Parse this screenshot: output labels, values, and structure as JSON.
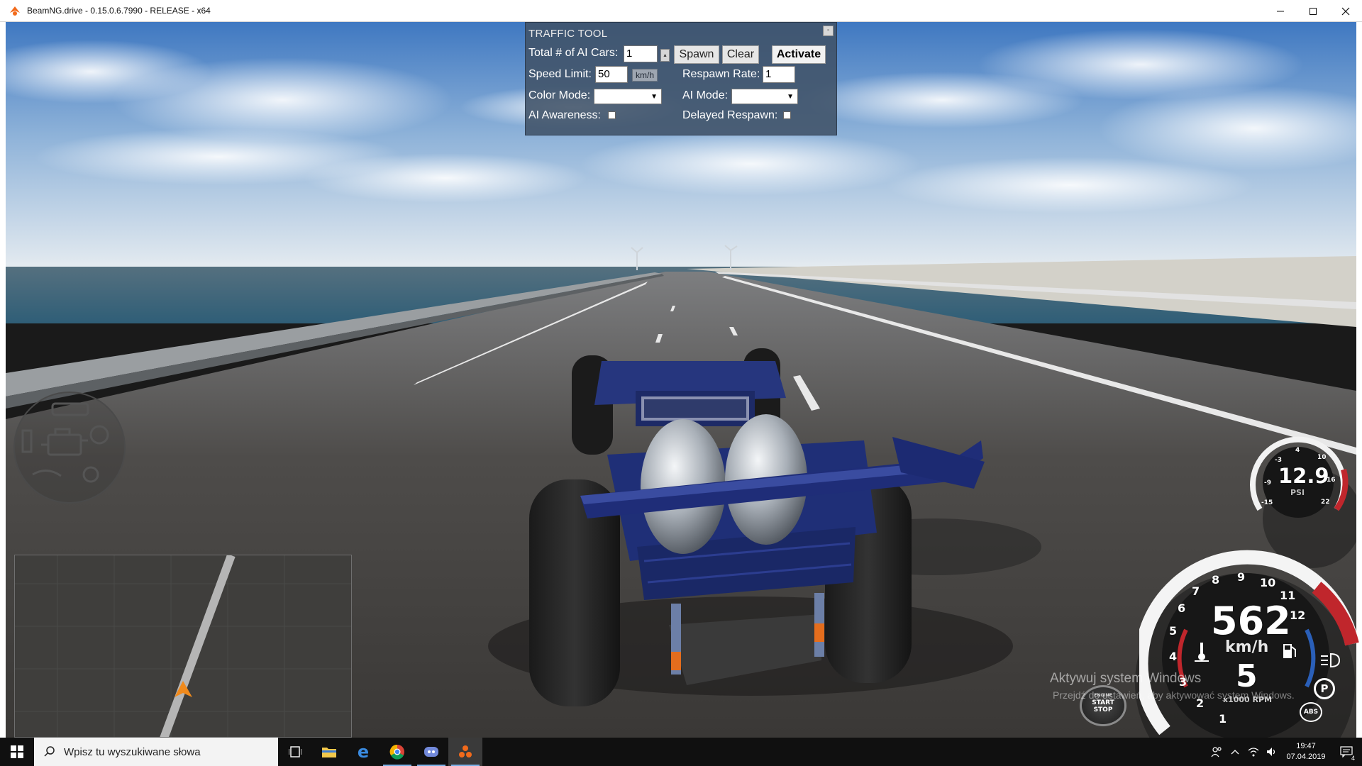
{
  "window": {
    "title": "BeamNG.drive - 0.15.0.6.7990 - RELEASE - x64"
  },
  "traffic_tool": {
    "title": "TRAFFIC TOOL",
    "minimize_label": "-",
    "total_ai_cars_label": "Total # of AI Cars:",
    "total_ai_cars_value": "1",
    "spawn_label": "Spawn",
    "clear_label": "Clear",
    "activate_label": "Activate",
    "speed_limit_label": "Speed Limit:",
    "speed_limit_value": "50",
    "speed_unit": "km/h",
    "respawn_rate_label": "Respawn Rate:",
    "respawn_rate_value": "1",
    "color_mode_label": "Color Mode:",
    "color_mode_value": "",
    "ai_mode_label": "AI Mode:",
    "ai_mode_value": "",
    "ai_awareness_label": "AI Awareness:",
    "ai_awareness_checked": false,
    "delayed_respawn_label": "Delayed Respawn:",
    "delayed_respawn_checked": false
  },
  "boost_gauge": {
    "value": "12.9",
    "unit": "PSI",
    "ticks": [
      "-15",
      "-9",
      "-3",
      "4",
      "10",
      "16",
      "22"
    ]
  },
  "speedometer": {
    "speed": "562",
    "speed_unit": "km/h",
    "gear": "5",
    "rpm_unit": "x1000 RPM",
    "rpm_ticks": [
      "1",
      "2",
      "3",
      "4",
      "5",
      "6",
      "7",
      "8",
      "9",
      "10",
      "11",
      "12"
    ],
    "abs_label": "ABS",
    "park_label": "P"
  },
  "engine_button": {
    "line1": "ENGINE",
    "line2": "START",
    "line3": "STOP"
  },
  "watermark": {
    "title": "Aktywuj system Windows",
    "subtitle": "Przejdź do ustawień, aby aktywować system Windows."
  },
  "taskbar": {
    "search_placeholder": "Wpisz tu wyszukiwane słowa",
    "time": "19:47",
    "date": "07.04.2019",
    "notification_count": "4"
  },
  "colors": {
    "panel_bg": "#405268",
    "car_body": "#1f2f7a",
    "taskbar": "#101010",
    "gauge_red": "#c0262c",
    "gauge_blue": "#2a5fb8"
  }
}
